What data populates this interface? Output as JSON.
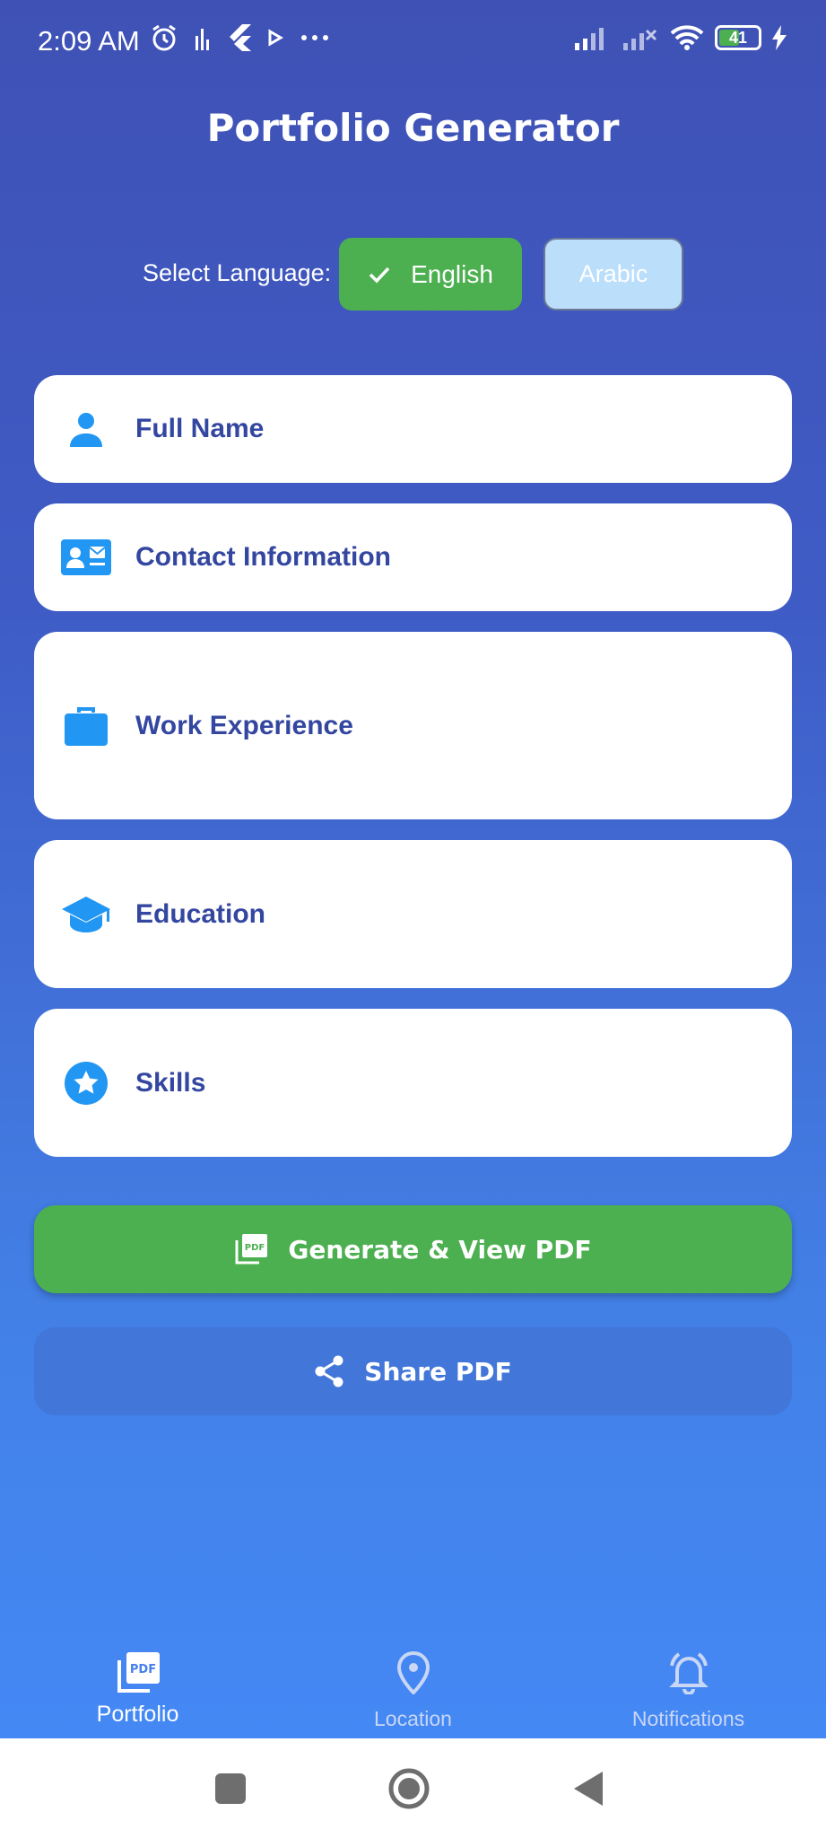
{
  "status_bar": {
    "time": "2:09 AM",
    "battery": "41"
  },
  "app": {
    "title": "Portfolio Generator"
  },
  "language": {
    "label": "Select Language:",
    "options": [
      "English",
      "Arabic"
    ],
    "selected": "English"
  },
  "sections": [
    {
      "label": "Full Name",
      "icon": "person-icon"
    },
    {
      "label": "Contact Information",
      "icon": "contact-card-icon"
    },
    {
      "label": "Work Experience",
      "icon": "briefcase-icon"
    },
    {
      "label": "Education",
      "icon": "graduation-cap-icon"
    },
    {
      "label": "Skills",
      "icon": "star-icon"
    }
  ],
  "actions": {
    "generate_label": "Generate & View PDF",
    "share_label": "Share PDF"
  },
  "bottom_nav": [
    {
      "label": "Portfolio",
      "icon": "pdf-icon",
      "active": true
    },
    {
      "label": "Location",
      "icon": "location-pin-icon",
      "active": false
    },
    {
      "label": "Notifications",
      "icon": "bell-icon",
      "active": false
    }
  ],
  "colors": {
    "green": "#4caf50",
    "accent_text": "#3346a0",
    "icon_blue": "#2196f3",
    "arabic_bg": "#bbdefb"
  }
}
